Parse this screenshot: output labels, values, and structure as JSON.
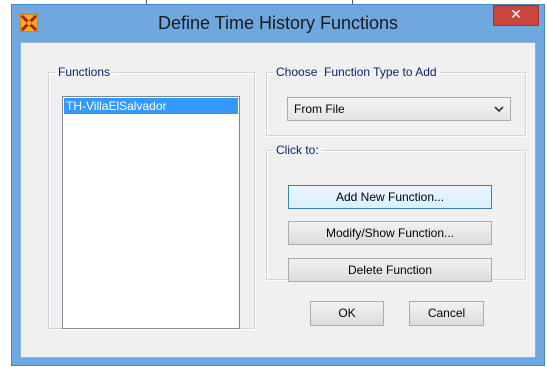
{
  "window": {
    "title": "Define Time History Functions",
    "close_label": "✕",
    "app_icon": "sap2000-x-icon"
  },
  "functions_group": {
    "legend": "Functions",
    "items": [
      "TH-VillaElSalvador"
    ],
    "selected_index": 0
  },
  "choose_group": {
    "legend": "Choose  Function Type to Add",
    "selected_value": "From File",
    "arrow_icon": "chevron-down-icon"
  },
  "click_group": {
    "legend": "Click to:",
    "add_label": "Add New Function...",
    "modify_label": "Modify/Show Function...",
    "delete_label": "Delete Function"
  },
  "footer": {
    "ok_label": "OK",
    "cancel_label": "Cancel"
  },
  "colors": {
    "title_bar": "#6ea8df",
    "close_button": "#c8463c",
    "selection": "#3399ff",
    "legend_text": "#0a246a",
    "dialog_bg": "#f0f0f0"
  }
}
